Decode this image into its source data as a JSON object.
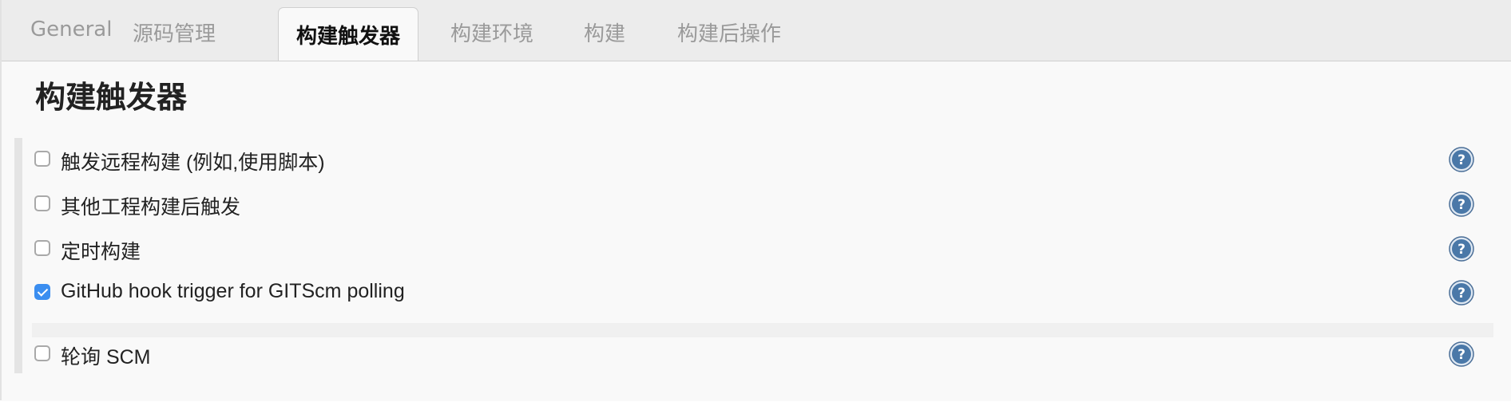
{
  "tabs": [
    {
      "label": "General"
    },
    {
      "label": "源码管理"
    },
    {
      "label": "构建触发器",
      "active": true
    },
    {
      "label": "构建环境"
    },
    {
      "label": "构建"
    },
    {
      "label": "构建后操作"
    }
  ],
  "section": {
    "title": "构建触发器"
  },
  "triggers": [
    {
      "label": "触发远程构建 (例如,使用脚本)",
      "checked": false
    },
    {
      "label": "其他工程构建后触发",
      "checked": false
    },
    {
      "label": "定时构建",
      "checked": false
    },
    {
      "label": "GitHub hook trigger for GITScm polling",
      "checked": true
    },
    {
      "label": "轮询 SCM",
      "checked": false
    }
  ],
  "icons": {
    "help": "help-icon",
    "check": "checkmark-icon"
  },
  "colors": {
    "accent": "#3b8ef0",
    "help_icon": "#4a78a8"
  }
}
